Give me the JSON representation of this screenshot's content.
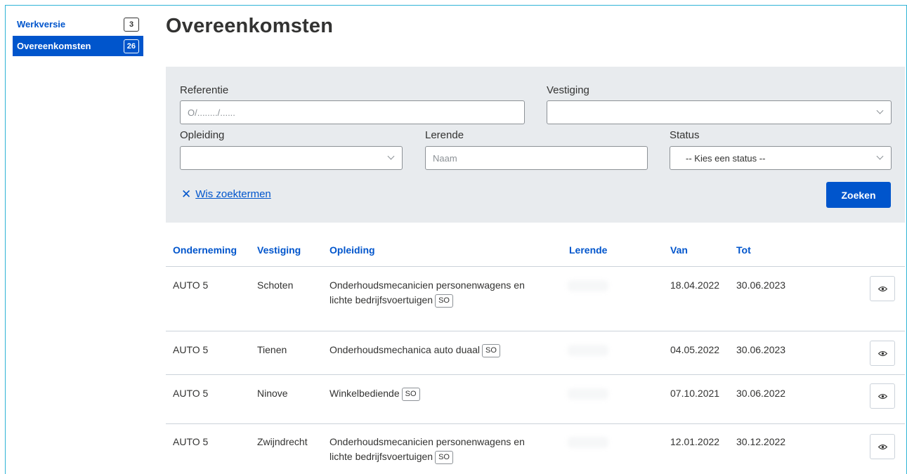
{
  "sidebar": {
    "items": [
      {
        "label": "Werkversie",
        "count": "3"
      },
      {
        "label": "Overeenkomsten",
        "count": "26"
      }
    ]
  },
  "page": {
    "title": "Overeenkomsten"
  },
  "filters": {
    "referentie": {
      "label": "Referentie",
      "placeholder": "O/......../......"
    },
    "vestiging": {
      "label": "Vestiging",
      "value": ""
    },
    "opleiding": {
      "label": "Opleiding",
      "value": ""
    },
    "lerende": {
      "label": "Lerende",
      "placeholder": "Naam"
    },
    "status": {
      "label": "Status",
      "value": "-- Kies een status --"
    },
    "clear_label": "Wis zoektermen",
    "search_label": "Zoeken"
  },
  "table": {
    "headers": [
      "Onderneming",
      "Vestiging",
      "Opleiding",
      "Lerende",
      "Van",
      "Tot"
    ],
    "rows": [
      {
        "onderneming": "AUTO 5",
        "vestiging": "Schoten",
        "opleiding_l1": "Onderhoudsmecanicien personenwagens en",
        "opleiding_l2": "lichte bedrijfsvoertuigen",
        "tag": "SO",
        "van": "18.04.2022",
        "tot": "30.06.2023"
      },
      {
        "onderneming": "AUTO 5",
        "vestiging": "Tienen",
        "opleiding_l1": "Onderhoudsmechanica auto duaal",
        "opleiding_l2": "",
        "tag": "SO",
        "van": "04.05.2022",
        "tot": "30.06.2023"
      },
      {
        "onderneming": "AUTO 5",
        "vestiging": "Ninove",
        "opleiding_l1": "Winkelbediende",
        "opleiding_l2": "",
        "tag": "SO",
        "van": "07.10.2021",
        "tot": "30.06.2022"
      },
      {
        "onderneming": "AUTO 5",
        "vestiging": "Zwijndrecht",
        "opleiding_l1": "Onderhoudsmecanicien personenwagens en",
        "opleiding_l2": "lichte bedrijfsvoertuigen",
        "tag": "SO",
        "van": "12.01.2022",
        "tot": "30.12.2022"
      }
    ]
  },
  "icons": {
    "view": "eye-icon",
    "clear": "close-icon",
    "dropdown": "chevron-down-icon"
  },
  "colors": {
    "accent": "#0055cc",
    "filter_bg": "#e8ebee",
    "frame": "#2fb4d6"
  }
}
